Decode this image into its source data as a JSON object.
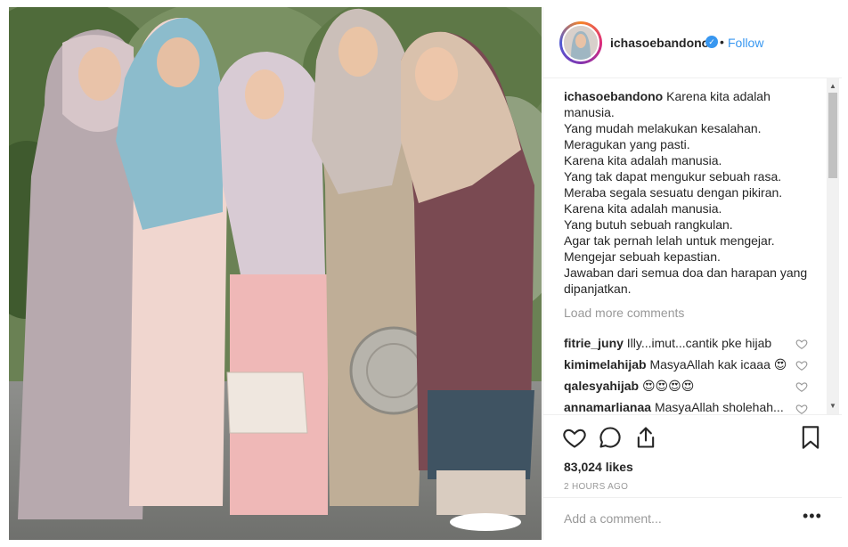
{
  "post": {
    "username": "ichasoebandono",
    "follow_label": "Follow",
    "separator": "•",
    "caption_user": "ichasoebandono",
    "caption_lines": [
      "Karena kita adalah",
      "manusia.",
      "Yang mudah melakukan kesalahan.",
      "Meragukan yang pasti.",
      "Karena kita adalah manusia.",
      "Yang tak dapat mengukur sebuah rasa.",
      "Meraba segala sesuatu dengan pikiran.",
      "Karena kita adalah manusia.",
      "Yang butuh sebuah rangkulan.",
      "Agar tak pernah lelah untuk mengejar.",
      "Mengejar sebuah kepastian.",
      "Jawaban dari semua doa dan harapan yang",
      "dipanjatkan."
    ],
    "load_more": "Load more comments",
    "comments": [
      {
        "user": "fitrie_juny",
        "text": "Illy...imut...cantik pke hijab"
      },
      {
        "user": "kimimelahijab",
        "text": "MasyaAllah kak icaaa 😍"
      },
      {
        "user": "qalesyahijab",
        "text": "😍😍😍😍"
      },
      {
        "user": "annamarlianaa",
        "text": "MasyaAllah sholehah..."
      }
    ],
    "likes": "83,024 likes",
    "time": "2 HOURS AGO",
    "add_comment_placeholder": "Add a comment...",
    "more_options": "•••"
  },
  "icons": {
    "verified": "verified-badge-icon",
    "like": "heart-icon",
    "comment": "comment-bubble-icon",
    "share": "share-icon",
    "save": "bookmark-icon",
    "comment_like": "small-heart-icon"
  },
  "colors": {
    "accent": "#3897f0",
    "muted": "#999999",
    "text": "#262626",
    "border": "#efefef"
  }
}
